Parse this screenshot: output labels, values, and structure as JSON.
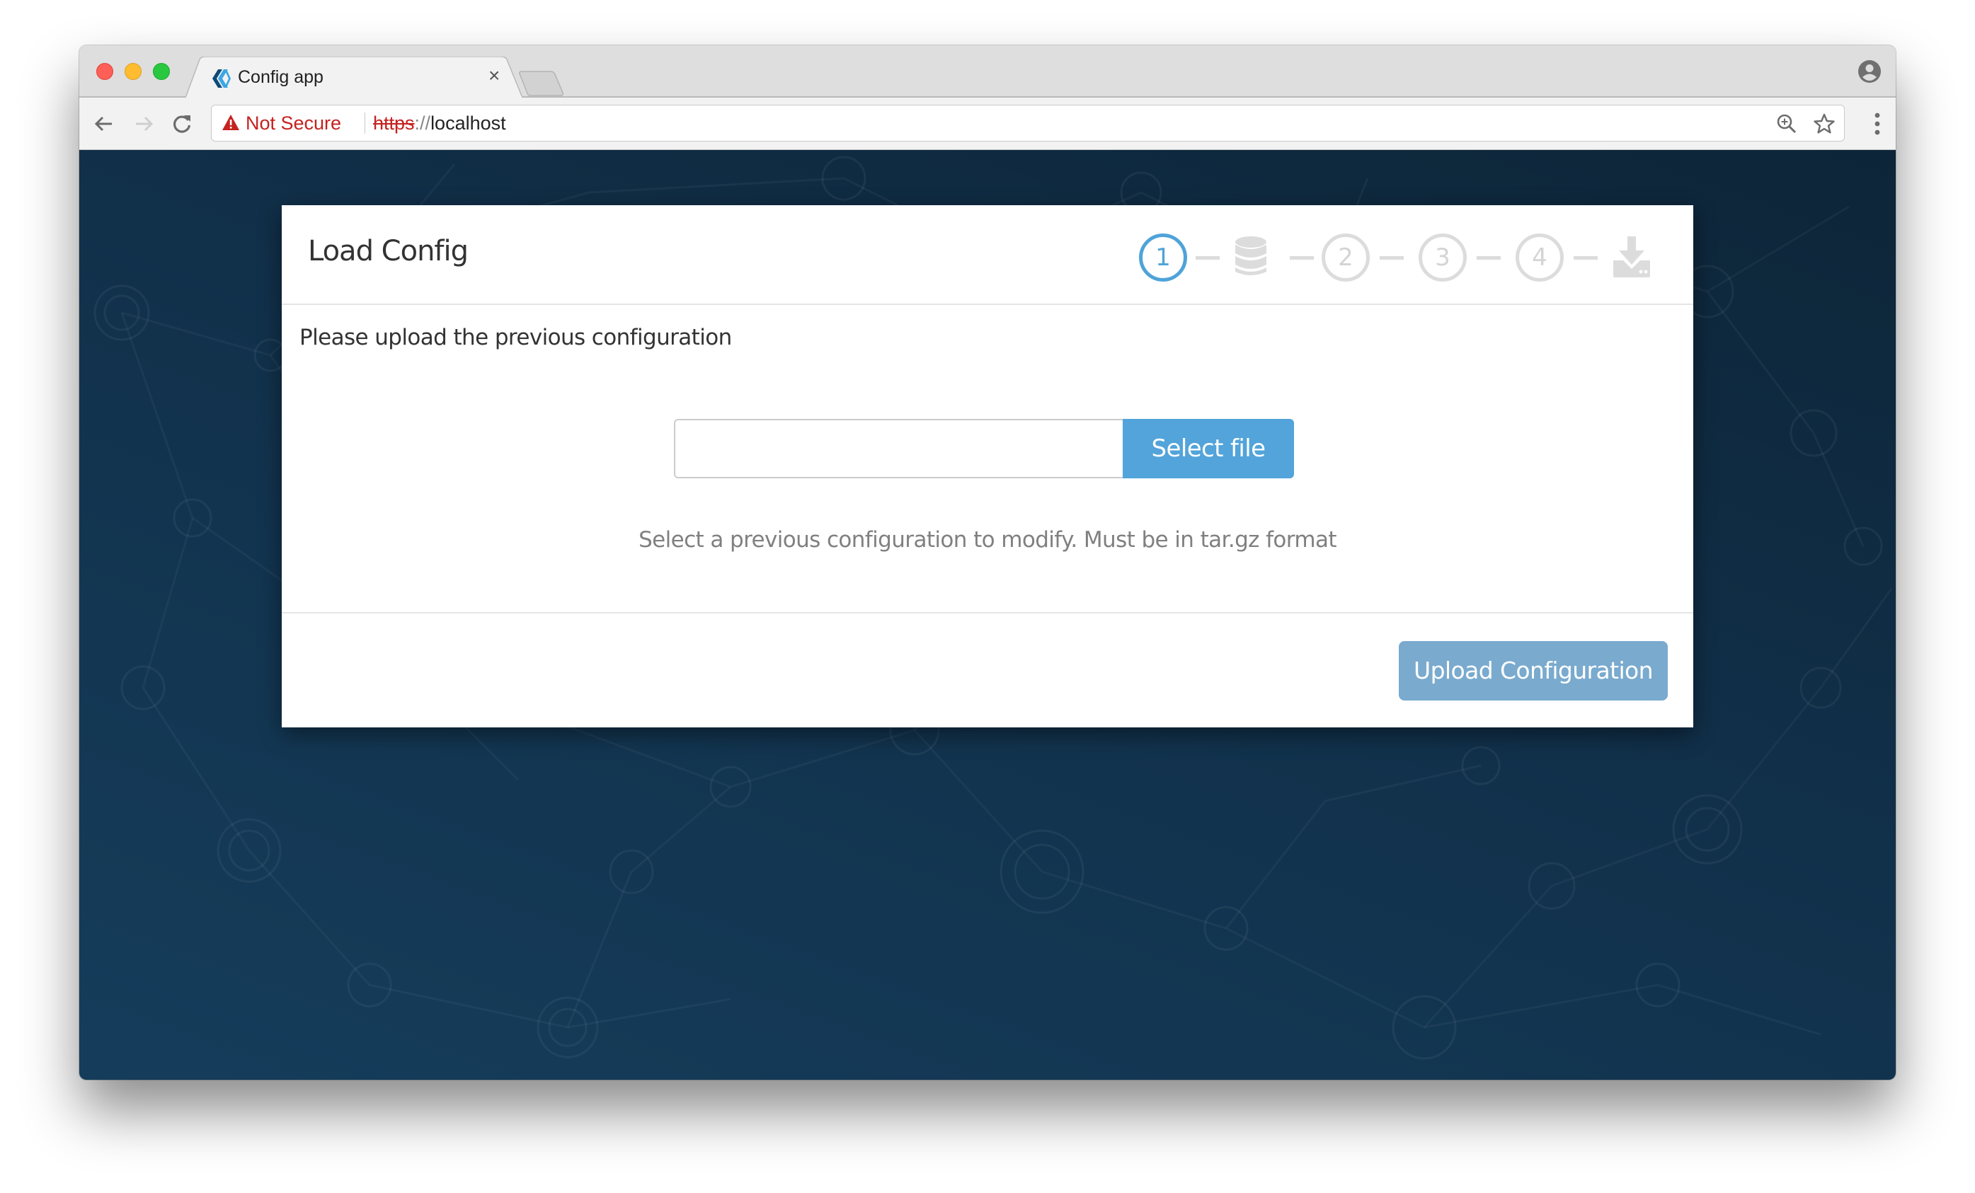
{
  "browser": {
    "tab": {
      "title": "Config app",
      "close_glyph": "×",
      "favicon": "config-app-logo-icon"
    },
    "address_bar": {
      "security_label": "Not Secure",
      "url_scheme": "https",
      "url_separator": "://",
      "url_host": "localhost"
    },
    "icons": {
      "back": "arrow-left-icon",
      "forward": "arrow-right-icon",
      "reload": "reload-icon",
      "warning": "warning-triangle-icon",
      "zoom": "zoom-in-icon",
      "bookmark": "star-icon",
      "menu": "kebab-menu-icon",
      "profile": "profile-icon"
    }
  },
  "card": {
    "title": "Load Config",
    "steps": [
      {
        "type": "number",
        "label": "1",
        "state": "active"
      },
      {
        "type": "icon",
        "icon": "database-icon",
        "state": "inactive"
      },
      {
        "type": "number",
        "label": "2",
        "state": "inactive"
      },
      {
        "type": "number",
        "label": "3",
        "state": "inactive"
      },
      {
        "type": "number",
        "label": "4",
        "state": "inactive"
      },
      {
        "type": "icon",
        "icon": "download-icon",
        "state": "inactive"
      }
    ],
    "intro": "Please upload the previous configuration",
    "file_input": {
      "value": "",
      "placeholder": ""
    },
    "select_file_label": "Select file",
    "help_text": "Select a previous configuration to modify. Must be in tar.gz format",
    "upload_label": "Upload Configuration"
  },
  "colors": {
    "accent": "#4fa3d8",
    "select_button": "#52a4da",
    "upload_button_disabled": "#7aaace",
    "step_inactive": "#dcdcdc",
    "not_secure_red": "#c5221f",
    "page_background": "#11304a"
  }
}
